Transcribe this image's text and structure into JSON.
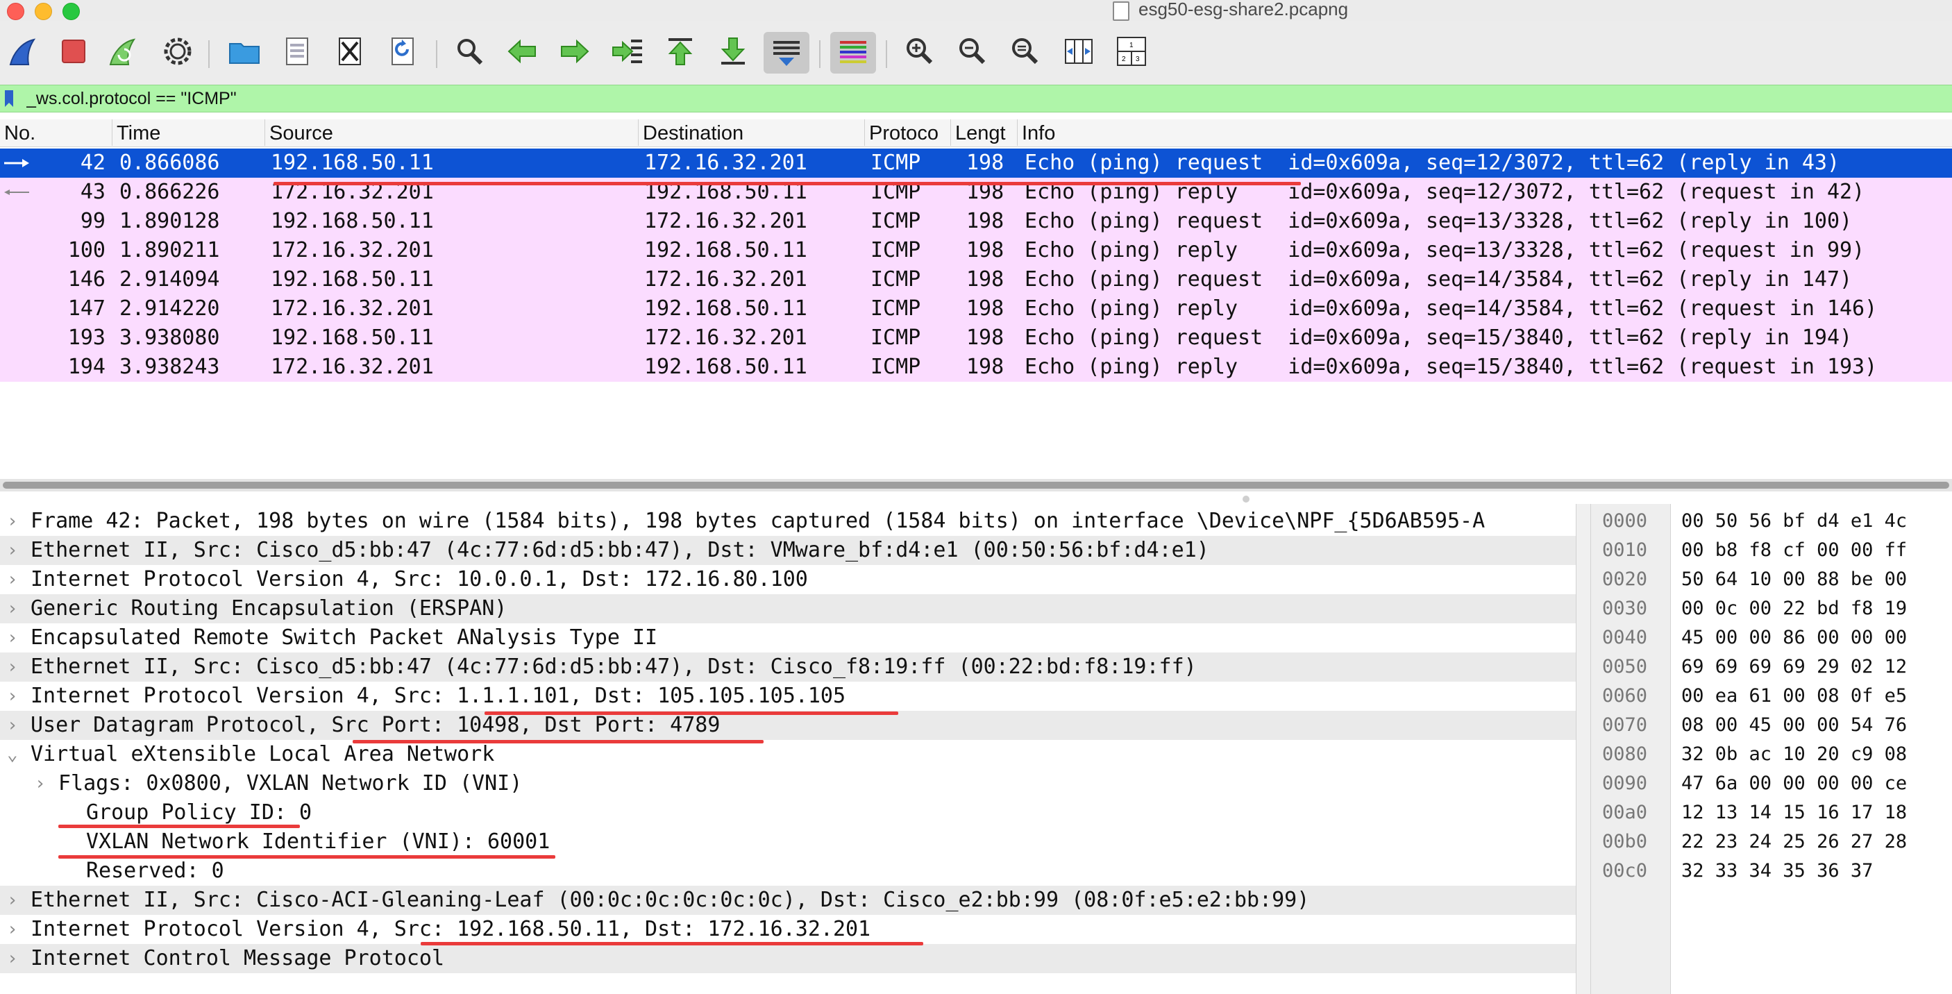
{
  "window": {
    "title": "esg50-esg-share2.pcapng"
  },
  "toolbar": {
    "icons": [
      "shark-fin-start-icon",
      "stop-capture-icon",
      "restart-capture-icon",
      "capture-options-gear-icon",
      "open-folder-icon",
      "save-file-icon",
      "close-file-icon",
      "reload-icon",
      "find-packet-icon",
      "go-back-arrow-icon",
      "go-forward-arrow-icon",
      "go-to-packet-icon",
      "go-first-packet-icon",
      "go-last-packet-icon",
      "auto-scroll-icon",
      "colorize-icon",
      "zoom-in-icon",
      "zoom-out-icon",
      "zoom-normal-icon",
      "resize-columns-icon",
      "layout-panes-icon"
    ]
  },
  "filter": {
    "value": "_ws.col.protocol == \"ICMP\""
  },
  "packet_list": {
    "columns": [
      "No.",
      "Time",
      "Source",
      "Destination",
      "Protoco",
      "Lengt",
      "Info"
    ],
    "rows": [
      {
        "no": "42",
        "time": "0.866086",
        "src": "192.168.50.11",
        "dst": "172.16.32.201",
        "proto": "ICMP",
        "len": "198",
        "info": "Echo (ping) request  id=0x609a, seq=12/3072, ttl=62 (reply in 43)"
      },
      {
        "no": "43",
        "time": "0.866226",
        "src": "172.16.32.201",
        "dst": "192.168.50.11",
        "proto": "ICMP",
        "len": "198",
        "info": "Echo (ping) reply    id=0x609a, seq=12/3072, ttl=62 (request in 42)"
      },
      {
        "no": "99",
        "time": "1.890128",
        "src": "192.168.50.11",
        "dst": "172.16.32.201",
        "proto": "ICMP",
        "len": "198",
        "info": "Echo (ping) request  id=0x609a, seq=13/3328, ttl=62 (reply in 100)"
      },
      {
        "no": "100",
        "time": "1.890211",
        "src": "172.16.32.201",
        "dst": "192.168.50.11",
        "proto": "ICMP",
        "len": "198",
        "info": "Echo (ping) reply    id=0x609a, seq=13/3328, ttl=62 (request in 99)"
      },
      {
        "no": "146",
        "time": "2.914094",
        "src": "192.168.50.11",
        "dst": "172.16.32.201",
        "proto": "ICMP",
        "len": "198",
        "info": "Echo (ping) request  id=0x609a, seq=14/3584, ttl=62 (reply in 147)"
      },
      {
        "no": "147",
        "time": "2.914220",
        "src": "172.16.32.201",
        "dst": "192.168.50.11",
        "proto": "ICMP",
        "len": "198",
        "info": "Echo (ping) reply    id=0x609a, seq=14/3584, ttl=62 (request in 146)"
      },
      {
        "no": "193",
        "time": "3.938080",
        "src": "192.168.50.11",
        "dst": "172.16.32.201",
        "proto": "ICMP",
        "len": "198",
        "info": "Echo (ping) request  id=0x609a, seq=15/3840, ttl=62 (reply in 194)"
      },
      {
        "no": "194",
        "time": "3.938243",
        "src": "172.16.32.201",
        "dst": "192.168.50.11",
        "proto": "ICMP",
        "len": "198",
        "info": "Echo (ping) reply    id=0x609a, seq=15/3840, ttl=62 (request in 193)"
      }
    ]
  },
  "details": {
    "rows": [
      "Frame 42: Packet, 198 bytes on wire (1584 bits), 198 bytes captured (1584 bits) on interface \\Device\\NPF_{5D6AB595-A",
      "Ethernet II, Src: Cisco_d5:bb:47 (4c:77:6d:d5:bb:47), Dst: VMware_bf:d4:e1 (00:50:56:bf:d4:e1)",
      "Internet Protocol Version 4, Src: 10.0.0.1, Dst: 172.16.80.100",
      "Generic Routing Encapsulation (ERSPAN)",
      "Encapsulated Remote Switch Packet ANalysis Type II",
      "Ethernet II, Src: Cisco_d5:bb:47 (4c:77:6d:d5:bb:47), Dst: Cisco_f8:19:ff (00:22:bd:f8:19:ff)",
      "Internet Protocol Version 4, Src: 1.1.1.101, Dst: 105.105.105.105",
      "User Datagram Protocol, Src Port: 10498, Dst Port: 4789",
      "Virtual eXtensible Local Area Network",
      "Flags: 0x0800, VXLAN Network ID (VNI)",
      "Group Policy ID: 0",
      "VXLAN Network Identifier (VNI): 60001",
      "Reserved: 0",
      "Ethernet II, Src: Cisco-ACI-Gleaning-Leaf (00:0c:0c:0c:0c:0c), Dst: Cisco_e2:bb:99 (08:0f:e5:e2:bb:99)",
      "Internet Protocol Version 4, Src: 192.168.50.11, Dst: 172.16.32.201",
      "Internet Control Message Protocol"
    ]
  },
  "bytes": {
    "rows": [
      {
        "off": "0000",
        "hex": "00 50 56 bf d4 e1 4c"
      },
      {
        "off": "0010",
        "hex": "00 b8 f8 cf 00 00 ff"
      },
      {
        "off": "0020",
        "hex": "50 64 10 00 88 be 00"
      },
      {
        "off": "0030",
        "hex": "00 0c 00 22 bd f8 19"
      },
      {
        "off": "0040",
        "hex": "45 00 00 86 00 00 00"
      },
      {
        "off": "0050",
        "hex": "69 69 69 69 29 02 12"
      },
      {
        "off": "0060",
        "hex": "00 ea 61 00 08 0f e5"
      },
      {
        "off": "0070",
        "hex": "08 00 45 00 00 54 76"
      },
      {
        "off": "0080",
        "hex": "32 0b ac 10 20 c9 08"
      },
      {
        "off": "0090",
        "hex": "47 6a 00 00 00 00 ce"
      },
      {
        "off": "00a0",
        "hex": "12 13 14 15 16 17 18"
      },
      {
        "off": "00b0",
        "hex": "22 23 24 25 26 27 28"
      },
      {
        "off": "00c0",
        "hex": "32 33 34 35 36 37"
      }
    ]
  },
  "colors": {
    "selected_row": "#0d53d4",
    "icmp_row": "#fbdcff",
    "filter_ok": "#aff5a9",
    "annotation_red": "#ea3b3b"
  }
}
